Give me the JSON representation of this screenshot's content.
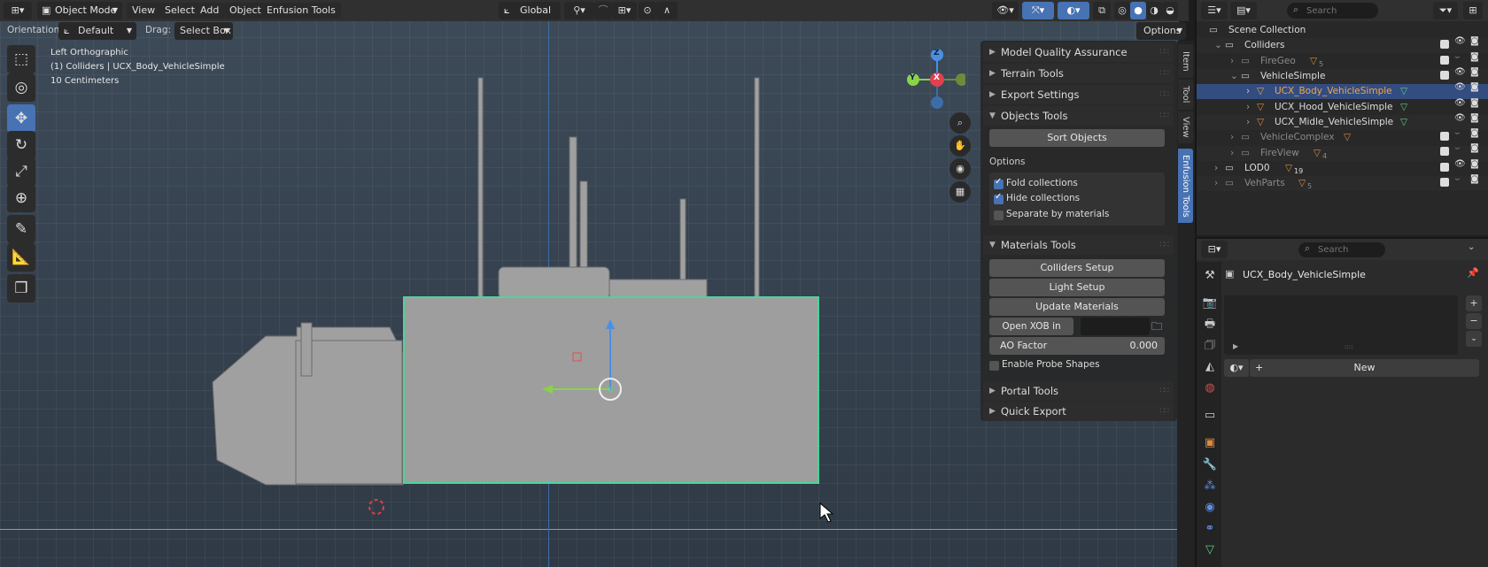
{
  "header": {
    "editor_icon": "viewport-editor-icon",
    "mode": "Object Mode",
    "menus": [
      "View",
      "Select",
      "Add",
      "Object",
      "Enfusion Tools"
    ],
    "orientation_header": "Global",
    "options_label": "Options"
  },
  "toolsettings": {
    "orientation_label": "Orientation:",
    "orientation_value": "Default",
    "drag_label": "Drag:",
    "drag_value": "Select Box"
  },
  "viewport": {
    "view_name": "Left Orthographic",
    "object_info": "(1) Colliders | UCX_Body_VehicleSimple",
    "scale": "10 Centimeters",
    "gizmo": {
      "z": "Z",
      "y": "Y",
      "x": "X"
    }
  },
  "sidebar": {
    "tabs": [
      "Item",
      "Tool",
      "View",
      "Enfusion Tools"
    ],
    "panels": {
      "mqa": "Model Quality Assurance",
      "terrain": "Terrain Tools",
      "export": "Export Settings",
      "objects": "Objects Tools",
      "sort_button": "Sort Objects",
      "options_label": "Options",
      "fold": "Fold collections",
      "hide": "Hide collections",
      "separate": "Separate by materials",
      "materials": "Materials Tools",
      "colliders_setup": "Colliders Setup",
      "light_setup": "Light Setup",
      "update_materials": "Update Materials",
      "open_xob": "Open XOB in Wor...",
      "ao_label": "AO Factor",
      "ao_value": "0.000",
      "probe": "Enable Probe Shapes",
      "portal": "Portal Tools",
      "quick_export": "Quick Export"
    }
  },
  "outliner": {
    "search_placeholder": "Search",
    "rows": [
      {
        "label": "Scene Collection",
        "count": ""
      },
      {
        "label": "Colliders",
        "count": ""
      },
      {
        "label": "FireGeo",
        "count": "5"
      },
      {
        "label": "VehicleSimple",
        "count": ""
      },
      {
        "label": "UCX_Body_VehicleSimple",
        "count": ""
      },
      {
        "label": "UCX_Hood_VehicleSimple",
        "count": ""
      },
      {
        "label": "UCX_Midle_VehicleSimple",
        "count": ""
      },
      {
        "label": "VehicleComplex",
        "count": ""
      },
      {
        "label": "FireView",
        "count": "4"
      },
      {
        "label": "LOD0",
        "count": "19"
      },
      {
        "label": "VehParts",
        "count": "5"
      }
    ]
  },
  "properties": {
    "search_placeholder": "Search",
    "object_name": "UCX_Body_VehicleSimple",
    "new_button": "New"
  },
  "colors": {
    "accent": "#4772b3",
    "selection_outline": "#4ed49a",
    "active_object": "#f2a44a"
  }
}
